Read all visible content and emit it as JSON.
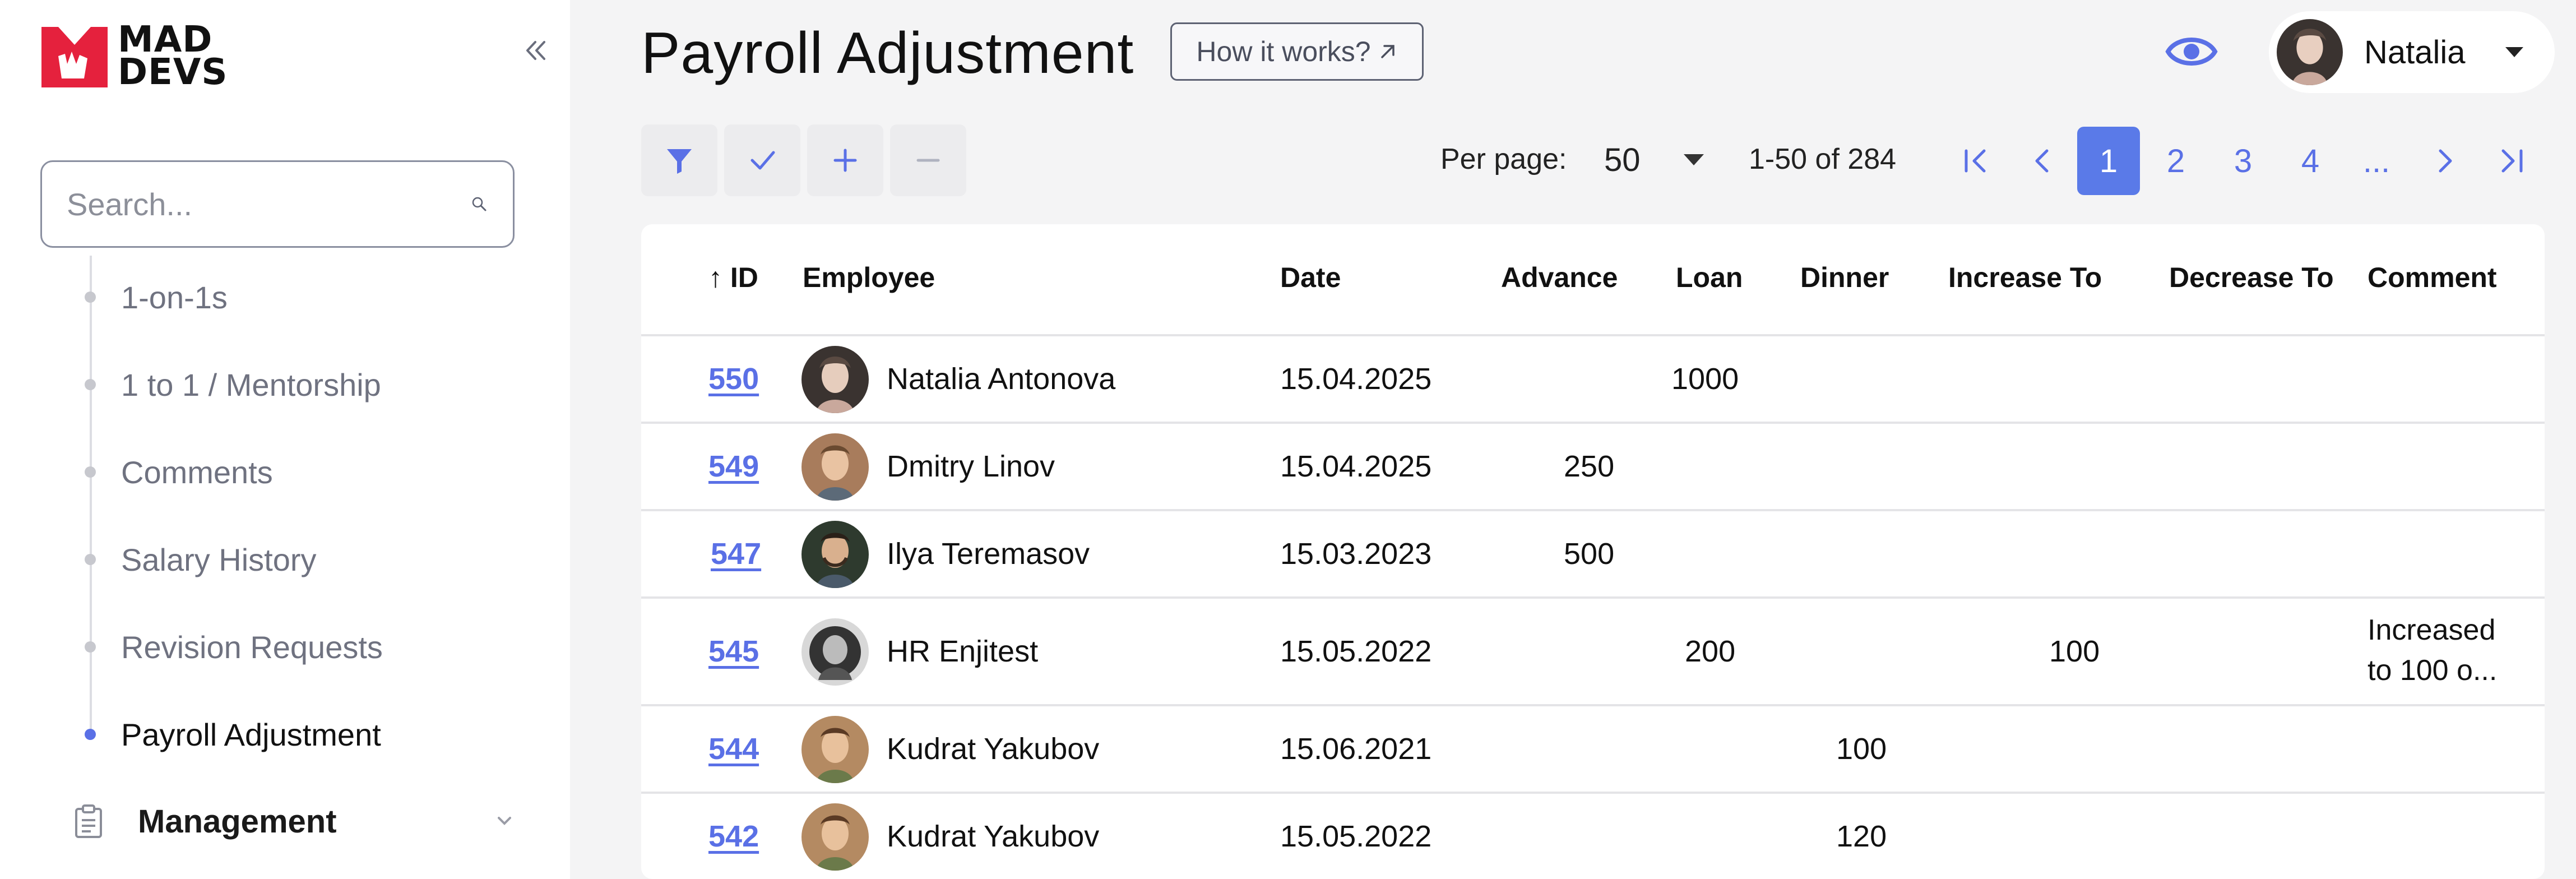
{
  "brand": {
    "line1": "MAD",
    "line2": "DEVS",
    "accent": "#e5213d"
  },
  "search": {
    "placeholder": "Search..."
  },
  "nav": {
    "items": [
      {
        "label": "1-on-1s",
        "active": false
      },
      {
        "label": "1 to 1 / Mentorship",
        "active": false
      },
      {
        "label": "Comments",
        "active": false
      },
      {
        "label": "Salary History",
        "active": false
      },
      {
        "label": "Revision Requests",
        "active": false
      },
      {
        "label": "Payroll Adjustment",
        "active": true
      }
    ],
    "section": {
      "label": "Management",
      "icon": "clipboard-icon"
    }
  },
  "header": {
    "title": "Payroll Adjustment",
    "how_it_works": "How it works?",
    "how_it_works_icon": "arrow-up-right-icon",
    "visibility_icon": "eye-icon",
    "user_name": "Natalia"
  },
  "toolbar": {
    "tools": [
      "filter-icon",
      "check-icon",
      "plus-icon",
      "minus-icon"
    ],
    "per_page_label": "Per page:",
    "per_page_value": "50",
    "range_text": "1-50 of 284"
  },
  "pagination": {
    "pages": [
      "1",
      "2",
      "3",
      "4",
      "..."
    ],
    "current": "1",
    "accent": "#5a7ae8"
  },
  "table": {
    "sort_arrow": "↑",
    "columns": {
      "id": "ID",
      "employee": "Employee",
      "date": "Date",
      "advance": "Advance",
      "loan": "Loan",
      "dinner": "Dinner",
      "increase_to": "Increase To",
      "decrease_to": "Decrease To",
      "comment": "Comment"
    },
    "rows": [
      {
        "id": "550",
        "employee": "Natalia Antonova",
        "date": "15.04.2025",
        "advance": "",
        "loan": "1000",
        "dinner": "",
        "increase_to": "",
        "decrease_to": "",
        "comment_line1": "",
        "comment_line2": ""
      },
      {
        "id": "549",
        "employee": "Dmitry Linov",
        "date": "15.04.2025",
        "advance": "250",
        "loan": "",
        "dinner": "",
        "increase_to": "",
        "decrease_to": "",
        "comment_line1": "",
        "comment_line2": ""
      },
      {
        "id": "547",
        "employee": "Ilya Teremasov",
        "date": "15.03.2023",
        "advance": "500",
        "loan": "",
        "dinner": "",
        "increase_to": "",
        "decrease_to": "",
        "comment_line1": "",
        "comment_line2": ""
      },
      {
        "id": "545",
        "employee": "HR Enjitest",
        "date": "15.05.2022",
        "advance": "",
        "loan": "200",
        "dinner": "",
        "increase_to": "100",
        "decrease_to": "",
        "comment_line1": "Increased",
        "comment_line2": "to 100 o..."
      },
      {
        "id": "544",
        "employee": "Kudrat Yakubov",
        "date": "15.06.2021",
        "advance": "",
        "loan": "",
        "dinner": "100",
        "increase_to": "",
        "decrease_to": "",
        "comment_line1": "",
        "comment_line2": ""
      },
      {
        "id": "542",
        "employee": "Kudrat Yakubov",
        "date": "15.05.2022",
        "advance": "",
        "loan": "",
        "dinner": "120",
        "increase_to": "",
        "decrease_to": "",
        "comment_line1": "",
        "comment_line2": ""
      }
    ]
  }
}
